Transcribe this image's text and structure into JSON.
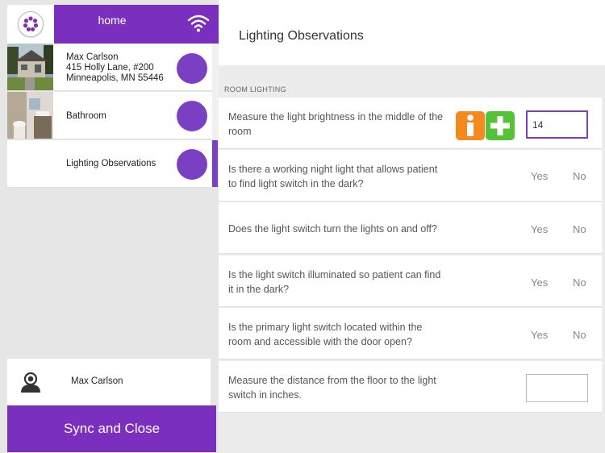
{
  "sidebar": {
    "home_label": "home",
    "items": [
      {
        "type": "client",
        "name": "Max Carlson",
        "address1": "415 Holly Lane, #200",
        "address2": "Minneapolis, MN  55446"
      },
      {
        "type": "room",
        "label": "Bathroom"
      },
      {
        "type": "section",
        "label": "Lighting Observations"
      }
    ],
    "user": {
      "name": "Max Carlson"
    },
    "sync_label": "Sync and Close"
  },
  "main": {
    "title": "Lighting Observations",
    "section_label": "ROOM LIGHTING",
    "questions": [
      {
        "text": "Measure the light brightness in the middle of the room",
        "type": "number",
        "value": "14"
      },
      {
        "text": "Is there a working night light that allows patient to find light switch in the dark?",
        "type": "yes-no",
        "yes": "Yes",
        "no": "No"
      },
      {
        "text": "Does the light switch turn the lights on and off?",
        "type": "yes-no",
        "yes": "Yes",
        "no": "No"
      },
      {
        "text": "Is the light switch illuminated so patient can find it in the dark?",
        "type": "yes-no",
        "yes": "Yes",
        "no": "No"
      },
      {
        "text": "Is the primary light switch located within the room and accessible with the door open?",
        "type": "yes-no",
        "yes": "Yes",
        "no": "No"
      },
      {
        "text": "Measure the distance from the floor to the light switch in inches.",
        "type": "number",
        "value": ""
      }
    ]
  },
  "colors": {
    "accent": "#7b2fbf",
    "circle": "#7b3fc4",
    "info": "#f28a1e",
    "add": "#55c23a"
  },
  "icons": {
    "logo": "flower-logo-icon",
    "wifi": "wifi-icon",
    "user": "user-avatar-icon",
    "info": "info-icon",
    "add": "plus-icon"
  }
}
